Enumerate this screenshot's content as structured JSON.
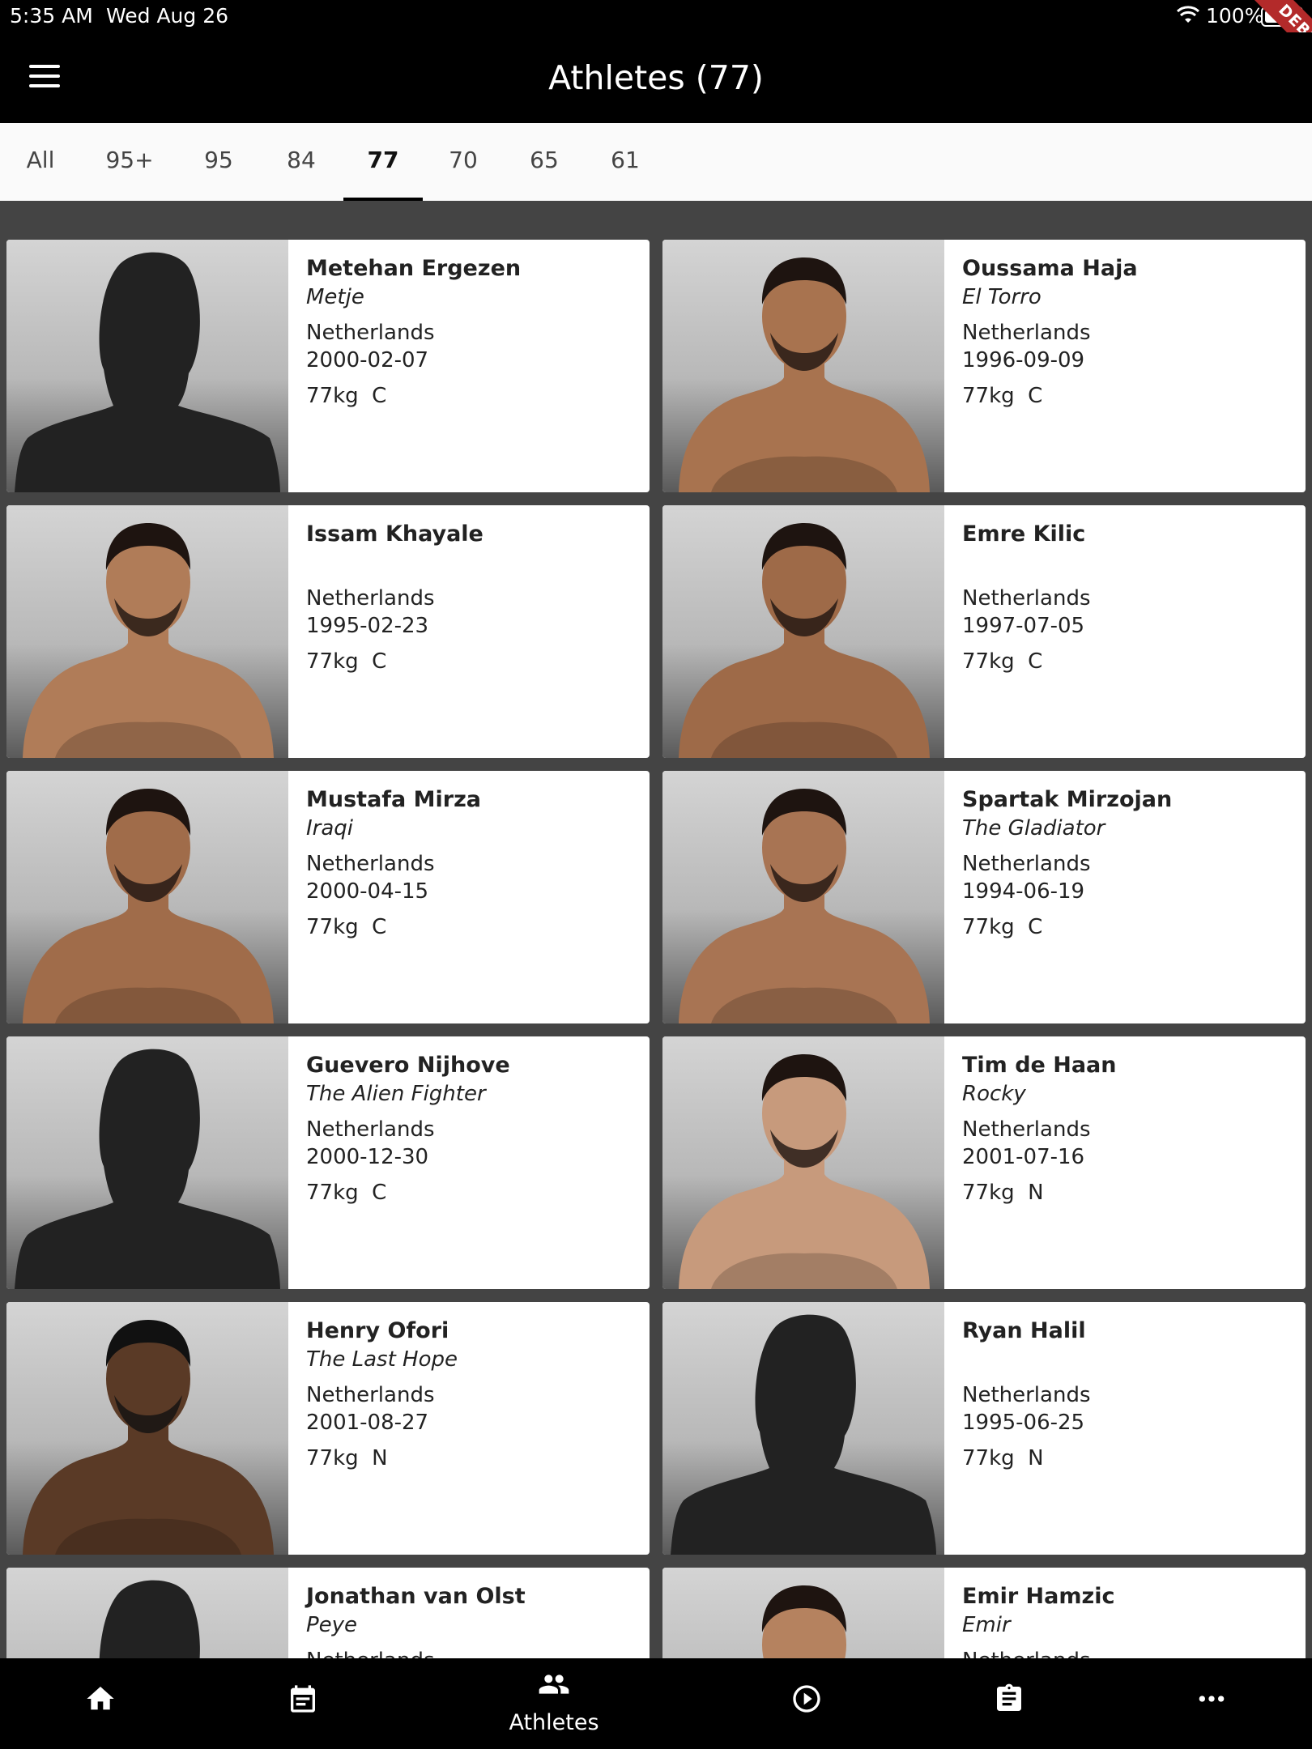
{
  "status_bar": {
    "time": "5:35 AM",
    "date": "Wed Aug 26",
    "battery": "100%",
    "debug": "DEBUG"
  },
  "app_bar": {
    "title": "Athletes (77)"
  },
  "tabs": [
    "All",
    "95+",
    "95",
    "84",
    "77",
    "70",
    "65",
    "61"
  ],
  "active_tab": "77",
  "athletes": [
    {
      "name": "Metehan Ergezen",
      "nickname": "Metje",
      "country": "Netherlands",
      "dob": "2000-02-07",
      "weight": "77kg  C",
      "photo": "silhouette"
    },
    {
      "name": "Oussama Haja",
      "nickname": "El Torro",
      "country": "Netherlands",
      "dob": "1996-09-09",
      "weight": "77kg  C",
      "photo": "person"
    },
    {
      "name": "Issam Khayale",
      "nickname": "",
      "country": "Netherlands",
      "dob": "1995-02-23",
      "weight": "77kg  C",
      "photo": "person"
    },
    {
      "name": "Emre Kilic",
      "nickname": "",
      "country": "Netherlands",
      "dob": "1997-07-05",
      "weight": "77kg  C",
      "photo": "person"
    },
    {
      "name": "Mustafa Mirza",
      "nickname": "Iraqi",
      "country": "Netherlands",
      "dob": "2000-04-15",
      "weight": "77kg  C",
      "photo": "person"
    },
    {
      "name": "Spartak Mirzojan",
      "nickname": "The Gladiator",
      "country": "Netherlands",
      "dob": "1994-06-19",
      "weight": "77kg  C",
      "photo": "person"
    },
    {
      "name": "Guevero Nijhove",
      "nickname": "The Alien Fighter",
      "country": "Netherlands",
      "dob": "2000-12-30",
      "weight": "77kg  C",
      "photo": "silhouette"
    },
    {
      "name": "Tim de Haan",
      "nickname": "Rocky",
      "country": "Netherlands",
      "dob": "2001-07-16",
      "weight": "77kg  N",
      "photo": "person"
    },
    {
      "name": "Henry Ofori",
      "nickname": "The Last Hope",
      "country": "Netherlands",
      "dob": "2001-08-27",
      "weight": "77kg  N",
      "photo": "person"
    },
    {
      "name": "Ryan Halil",
      "nickname": "",
      "country": "Netherlands",
      "dob": "1995-06-25",
      "weight": "77kg  N",
      "photo": "silhouette"
    },
    {
      "name": "Jonathan van Olst",
      "nickname": "Peye",
      "country": "Netherlands",
      "dob": "",
      "weight": "",
      "photo": "silhouette"
    },
    {
      "name": "Emir Hamzic",
      "nickname": "Emir",
      "country": "Netherlands",
      "dob": "",
      "weight": "",
      "photo": "person"
    }
  ],
  "bottom_nav": [
    {
      "icon": "home-icon",
      "label": ""
    },
    {
      "icon": "calendar-icon",
      "label": ""
    },
    {
      "icon": "people-icon",
      "label": "Athletes"
    },
    {
      "icon": "play-circle-icon",
      "label": ""
    },
    {
      "icon": "clipboard-icon",
      "label": ""
    },
    {
      "icon": "more-icon",
      "label": ""
    }
  ],
  "colors": {
    "app_bar": "#000000",
    "background": "#444444",
    "card": "#ffffff",
    "tab_bar": "#fafafa"
  }
}
